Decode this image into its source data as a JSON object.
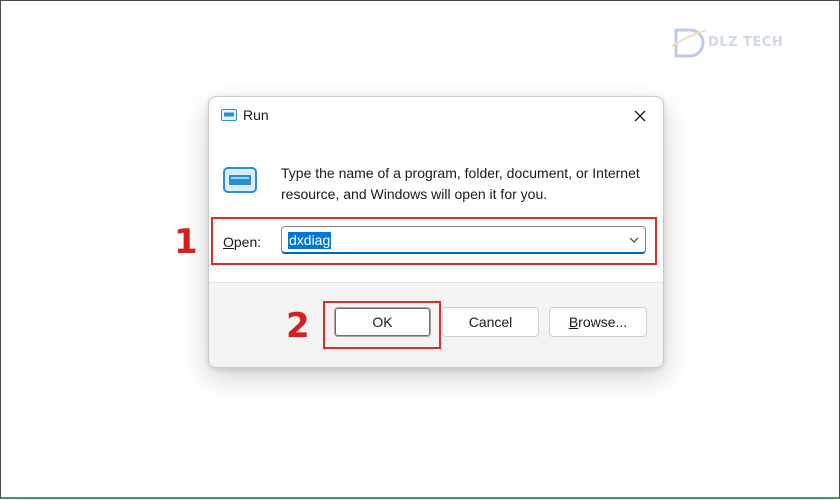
{
  "watermark": {
    "text": "DLZ TECH"
  },
  "dialog": {
    "title": "Run",
    "description": "Type the name of a program, folder, document, or Internet resource, and Windows will open it for you.",
    "open_label_prefix": "O",
    "open_label_rest": "pen:",
    "open_value": "dxdiag",
    "buttons": {
      "ok": "OK",
      "cancel": "Cancel",
      "browse_prefix": "B",
      "browse_rest": "rowse..."
    }
  },
  "annotations": {
    "step1": "1",
    "step2": "2",
    "highlight_color": "#e02b2b"
  },
  "colors": {
    "accent": "#0078d4",
    "annotation_red": "#d62020"
  }
}
